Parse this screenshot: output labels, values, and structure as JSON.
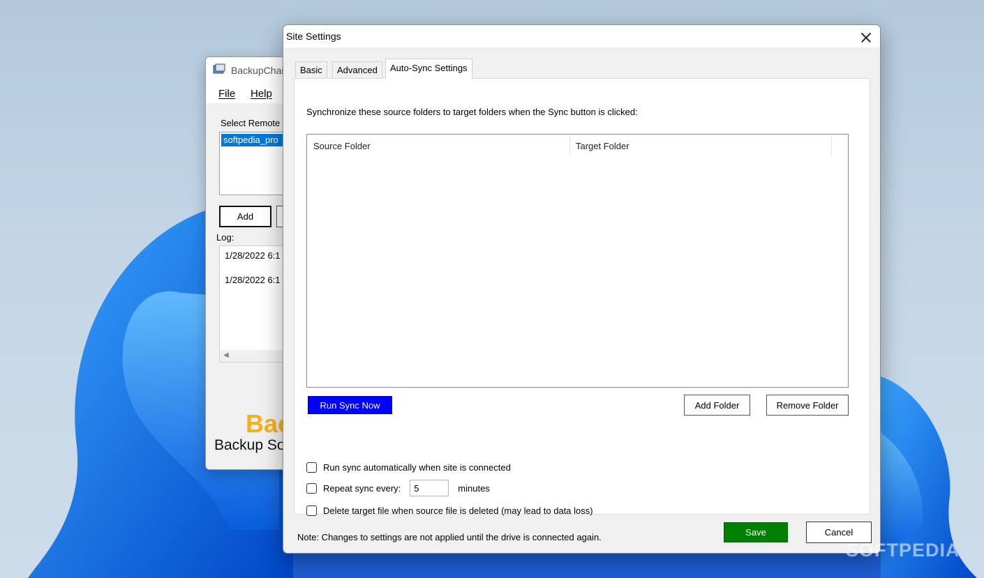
{
  "background_window": {
    "title": "BackupChai",
    "menu": [
      "File",
      "Help"
    ],
    "select_label": "Select Remote",
    "selected_item": "softpedia_pro",
    "add_button": "Add",
    "log_label": "Log:",
    "log_lines": [
      "1/28/2022 6:1",
      "1/28/2022 6:1"
    ],
    "brand_big": "Bac",
    "brand_sub": "Backup So"
  },
  "dialog": {
    "title": "Site Settings",
    "tabs": [
      {
        "label": "Basic"
      },
      {
        "label": "Advanced"
      },
      {
        "label": "Auto-Sync Settings",
        "active": true
      }
    ],
    "description": "Synchronize these source folders to target folders when the Sync button is clicked:",
    "table": {
      "columns": [
        "Source Folder",
        "Target Folder"
      ],
      "rows": []
    },
    "buttons": {
      "run_sync": "Run Sync Now",
      "add_folder": "Add Folder",
      "remove_folder": "Remove Folder",
      "save": "Save",
      "cancel": "Cancel"
    },
    "options": {
      "run_on_connect": {
        "label": "Run sync automatically when site is connected",
        "checked": false
      },
      "repeat": {
        "label": "Repeat sync every:",
        "checked": false,
        "value": "5",
        "unit": "minutes"
      },
      "delete_target": {
        "label": "Delete target file when source file is deleted (may lead to data loss)",
        "checked": false
      }
    },
    "note": "Note: Changes to settings are not applied until the drive is connected again."
  },
  "watermark": "SOFTPEDIA",
  "colors": {
    "run_sync_bg": "#0000ff",
    "save_bg": "#008000",
    "selection": "#0078d7",
    "brand": "#f6b11a"
  }
}
